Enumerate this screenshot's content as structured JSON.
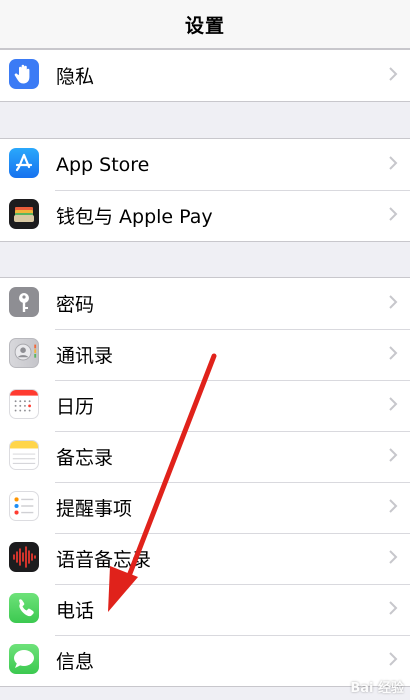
{
  "navbar": {
    "title": "设置"
  },
  "groups": [
    {
      "items": [
        {
          "label": "隐私",
          "icon": "hand-icon",
          "color": "#3b7bf5"
        }
      ]
    },
    {
      "items": [
        {
          "label": "App Store",
          "icon": "app-store-icon",
          "color": "#1d8ef5"
        },
        {
          "label": "钱包与 Apple Pay",
          "icon": "wallet-icon",
          "color": "#1c1c1e"
        }
      ]
    },
    {
      "items": [
        {
          "label": "密码",
          "icon": "key-icon",
          "color": "#8e8e93"
        },
        {
          "label": "通讯录",
          "icon": "contacts-icon",
          "color": "#c9c9ce"
        },
        {
          "label": "日历",
          "icon": "calendar-icon",
          "color": "#ffffff"
        },
        {
          "label": "备忘录",
          "icon": "notes-icon",
          "color": "#ffd54a"
        },
        {
          "label": "提醒事项",
          "icon": "reminders-icon",
          "color": "#ffffff"
        },
        {
          "label": "语音备忘录",
          "icon": "voice-memos-icon",
          "color": "#1c1c1e"
        },
        {
          "label": "电话",
          "icon": "phone-icon",
          "color": "#4cd964"
        },
        {
          "label": "信息",
          "icon": "messages-icon",
          "color": "#4cd964"
        }
      ]
    }
  ],
  "annotation": {
    "arrow_color": "#e0221b"
  },
  "watermark": "Bai 经验"
}
